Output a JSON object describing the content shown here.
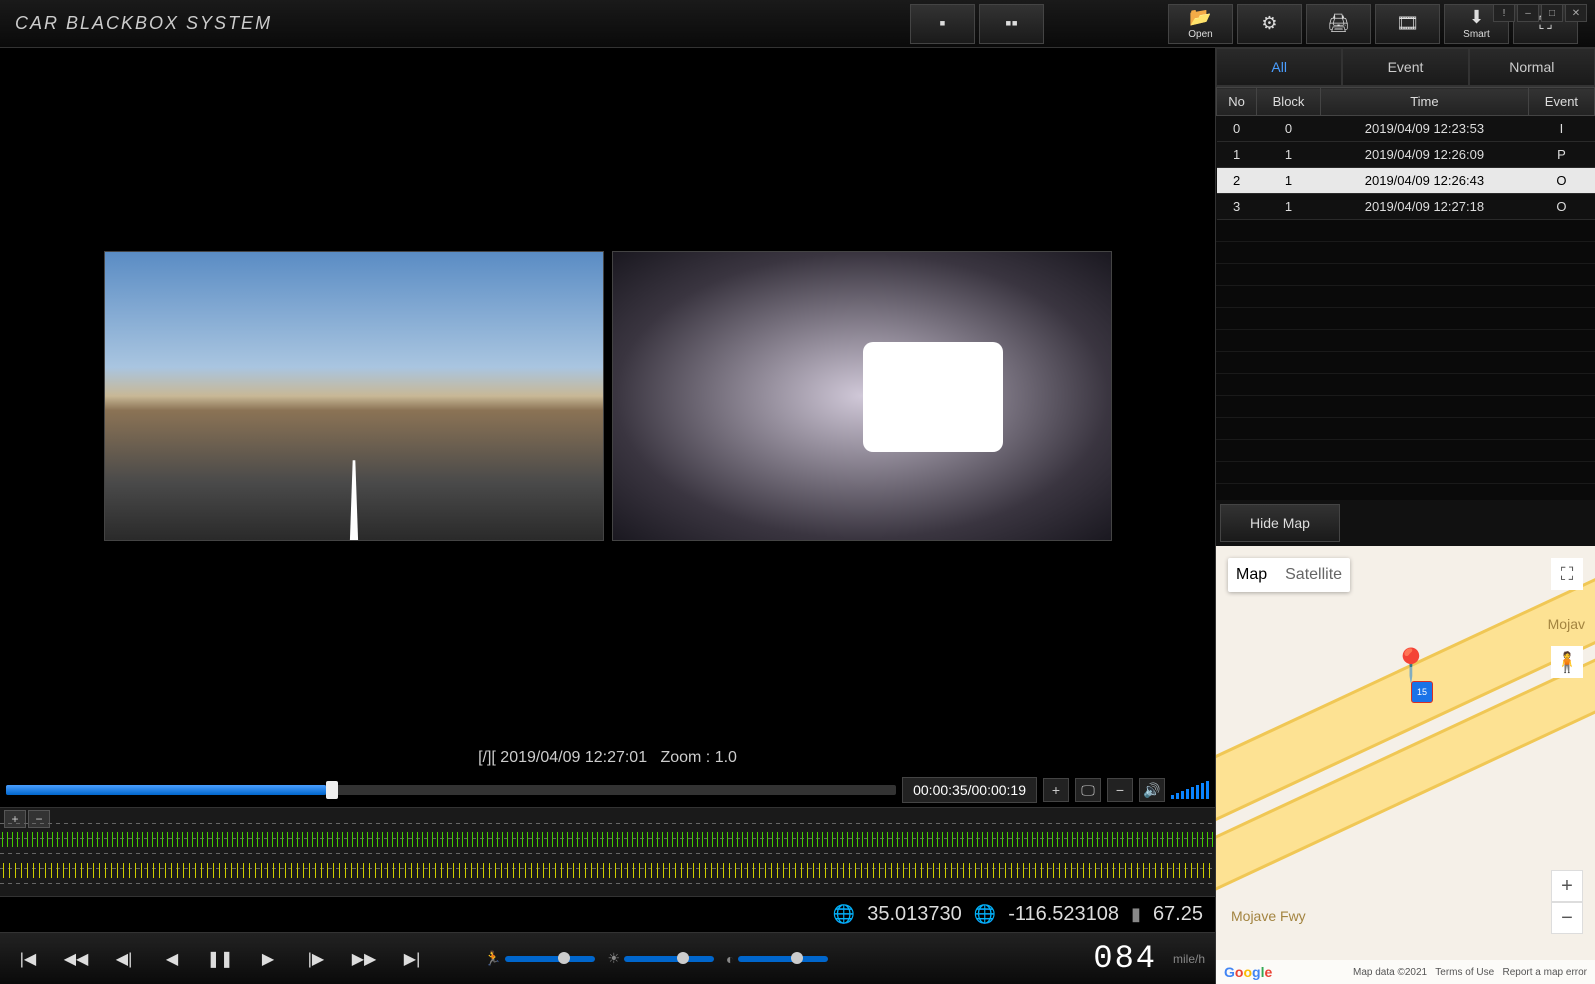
{
  "app_title": "CAR BLACKBOX SYSTEM",
  "toolbar": {
    "open": "Open",
    "smart": "Smart"
  },
  "status": {
    "prefix": "[/][",
    "datetime": "2019/04/09 12:27:01",
    "zoom_label": "Zoom : 1.0"
  },
  "playback": {
    "time_display": "00:00:35/00:00:19"
  },
  "gps": {
    "lat": "35.013730",
    "lon": "-116.523108",
    "alt": "67.25"
  },
  "speed": {
    "value": "084",
    "unit": "mile/h"
  },
  "tabs": {
    "all": "All",
    "event": "Event",
    "normal": "Normal"
  },
  "table": {
    "headers": {
      "no": "No",
      "block": "Block",
      "time": "Time",
      "event": "Event"
    },
    "rows": [
      {
        "no": "0",
        "block": "0",
        "time": "2019/04/09 12:23:53",
        "event": "I",
        "selected": false
      },
      {
        "no": "1",
        "block": "1",
        "time": "2019/04/09 12:26:09",
        "event": "P",
        "selected": false
      },
      {
        "no": "2",
        "block": "1",
        "time": "2019/04/09 12:26:43",
        "event": "O",
        "selected": true
      },
      {
        "no": "3",
        "block": "1",
        "time": "2019/04/09 12:27:18",
        "event": "O",
        "selected": false
      }
    ]
  },
  "map": {
    "hide_btn": "Hide Map",
    "tab_map": "Map",
    "tab_satellite": "Satellite",
    "road_name": "Mojave Fwy",
    "road_short": "Mojav",
    "shield": "15",
    "attribution": "Map data ©2021",
    "terms": "Terms of Use",
    "report": "Report a map error"
  }
}
